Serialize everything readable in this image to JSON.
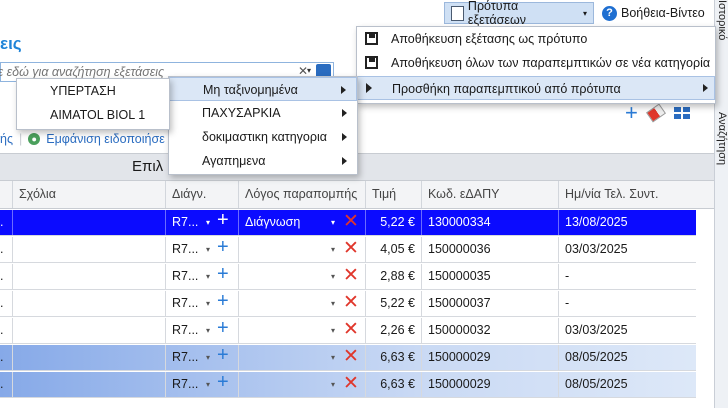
{
  "topbar": {
    "templates_label": "Πρότυπα εξετάσεων",
    "help_label": "Βοήθεια-Βίντεο"
  },
  "right_panel": {
    "label": "Ιστορικό",
    "label_2": "Αναζήτηση"
  },
  "page": {
    "title": "εις"
  },
  "search": {
    "placeholder": "τε εδώ για αναζήτηση εξετάσεις"
  },
  "toolbar": {
    "left_cut": "ής",
    "show_label": "Εμφάνιση ειδοποιήσε"
  },
  "group_header": "Επιλ",
  "columns": [
    "Σχόλια",
    "Διάγν.",
    "Λόγος παραπομπής",
    "Τιμή",
    "Κωδ. εΔΑΠΥ",
    "Ημ/νία Τελ. Συντ."
  ],
  "rows": [
    {
      "lead": ".",
      "diag": "R7...",
      "reason": "Διάγνωση",
      "price": "5,22 €",
      "code": "130000334",
      "date": "13/08/2025",
      "state": "selected"
    },
    {
      "lead": ".",
      "diag": "R7...",
      "reason": "",
      "price": "4,05 €",
      "code": "150000036",
      "date": "03/03/2025",
      "state": ""
    },
    {
      "lead": ".",
      "diag": "R7...",
      "reason": "",
      "price": "2,88 €",
      "code": "150000035",
      "date": "-",
      "state": ""
    },
    {
      "lead": ".",
      "diag": "R7...",
      "reason": "",
      "price": "5,22 €",
      "code": "150000037",
      "date": "-",
      "state": ""
    },
    {
      "lead": ".",
      "diag": "R7...",
      "reason": "",
      "price": "2,26 €",
      "code": "150000032",
      "date": "03/03/2025",
      "state": ""
    },
    {
      "lead": ".",
      "diag": "R7...",
      "reason": "",
      "price": "6,63 €",
      "code": "150000029",
      "date": "08/05/2025",
      "state": "highlight"
    },
    {
      "lead": ".",
      "diag": "R7...",
      "reason": "",
      "price": "6,63 €",
      "code": "150000029",
      "date": "08/05/2025",
      "state": "highlight"
    }
  ],
  "menu_templates": [
    {
      "label": "Αποθήκευση εξέτασης ως πρότυπο",
      "icon": "floppy-icon"
    },
    {
      "label": "Αποθήκευση όλων των παραπεμπτικών σε νέα κατηγορία",
      "icon": "floppy-multi-icon"
    },
    {
      "label": "Προσθήκη παραπεμπτικού από πρότυπα",
      "icon": "triangle-right-icon"
    }
  ],
  "menu_categories": [
    "Μη ταξινομημένα",
    "ΠΑΧΥΣΑΡΚΙΑ",
    "δοκιμαστικη κατηγορια",
    "Αγαπημενα"
  ],
  "menu_items": [
    "ΥΠΕΡΤΑΣΗ",
    "AIMATOL BIOL 1"
  ],
  "colors": {
    "accent": "#1f84d8",
    "selected_row": "#0b0bff",
    "delete": "#e0362b"
  }
}
